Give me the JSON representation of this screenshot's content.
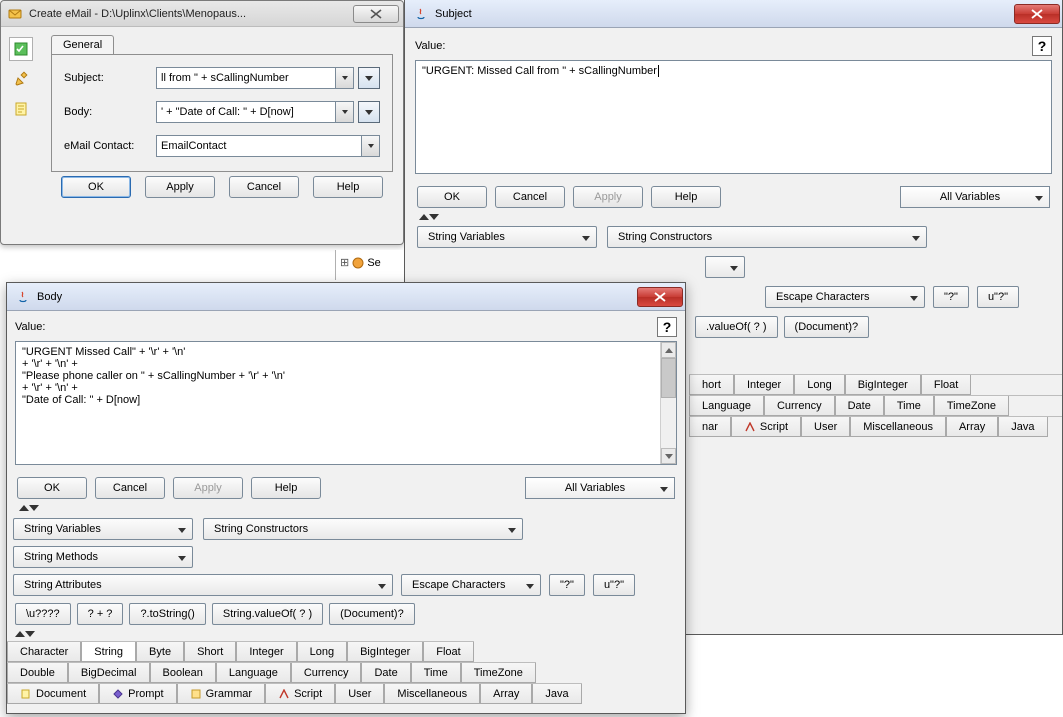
{
  "createMail": {
    "title": "Create eMail - D:\\Uplinx\\Clients\\Menopaus...",
    "tabs": {
      "general": "General"
    },
    "labels": {
      "subject": "Subject:",
      "body": "Body:",
      "emailContact": "eMail Contact:"
    },
    "fields": {
      "subjectValue": "ll from \" + sCallingNumber",
      "bodyValue": "' + \"Date of Call: \" + D[now]",
      "emailContactValue": "EmailContact"
    },
    "buttons": {
      "ok": "OK",
      "apply": "Apply",
      "cancel": "Cancel",
      "help": "Help"
    }
  },
  "tree": {
    "item": "Se"
  },
  "subject": {
    "title": "Subject",
    "valueLabel": "Value:",
    "value": "\"URGENT: Missed Call from \" + sCallingNumber",
    "buttons": {
      "ok": "OK",
      "cancel": "Cancel",
      "apply": "Apply",
      "help": "Help"
    },
    "allVariables": "All Variables",
    "drops": {
      "stringVariables": "String Variables",
      "stringConstructors": "String Constructors",
      "escapeChars": "Escape Characters"
    },
    "btns": {
      "q": "\"?\"",
      "uq": "u\"?\"",
      "valueOf": ".valueOf( ? )",
      "document": "(Document)?"
    },
    "tabsRow1": [
      "hort",
      "Integer",
      "Long",
      "BigInteger",
      "Float"
    ],
    "tabsRow2": [
      "Language",
      "Currency",
      "Date",
      "Time",
      "TimeZone"
    ],
    "tabsRow3": [
      "nar",
      "Script",
      "User",
      "Miscellaneous",
      "Array",
      "Java"
    ]
  },
  "bodyWin": {
    "title": "Body",
    "valueLabel": "Value:",
    "text": "\"URGENT Missed Call\" + '\\r' + '\\n'\n+ '\\r' + '\\n' +\n\"Please phone caller on \" + sCallingNumber + '\\r' + '\\n'\n+ '\\r' + '\\n' +\n\"Date of Call: \" + D[now]",
    "buttons": {
      "ok": "OK",
      "cancel": "Cancel",
      "apply": "Apply",
      "help": "Help"
    },
    "allVariables": "All Variables",
    "drops": {
      "stringVariables": "String Variables",
      "stringConstructors": "String Constructors",
      "stringMethods": "String Methods",
      "stringAttributes": "String Attributes",
      "escapeChars": "Escape Characters"
    },
    "btns": {
      "q": "\"?\"",
      "uq": "u\"?\"",
      "u4": "\\u????",
      "plus": "? + ?",
      "toString": "?.toString()",
      "valueOf": "String.valueOf( ? )",
      "document": "(Document)?"
    },
    "tabsRow1": [
      "Character",
      "String",
      "Byte",
      "Short",
      "Integer",
      "Long",
      "BigInteger",
      "Float"
    ],
    "tabsRow2": [
      "Double",
      "BigDecimal",
      "Boolean",
      "Language",
      "Currency",
      "Date",
      "Time",
      "TimeZone"
    ],
    "tabsRow3": [
      "Document",
      "Prompt",
      "Grammar",
      "Script",
      "User",
      "Miscellaneous",
      "Array",
      "Java"
    ]
  }
}
